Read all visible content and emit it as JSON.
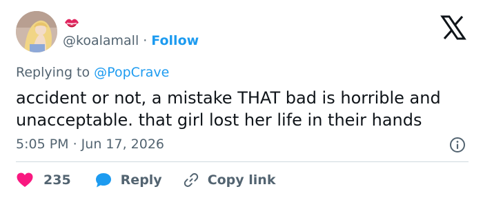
{
  "tweet": {
    "display_name_emoji": "kiss-mark-icon",
    "handle": "@koalamall",
    "separator": "·",
    "follow_label": "Follow",
    "replying_prefix": "Replying to",
    "replying_to": "@PopCrave",
    "text_line1": "accident or not, a mistake THAT bad is horrible and",
    "text_line2": "unacceptable. that girl lost her life in their hands",
    "timestamp": "5:05 PM · Jun 17, 2026",
    "like_count": "235",
    "reply_label": "Reply",
    "copy_link_label": "Copy link"
  },
  "icons": {
    "brand": "x-logo-icon",
    "info": "info-icon",
    "like": "heart-icon",
    "reply": "speech-bubble-icon",
    "copy": "link-icon"
  },
  "colors": {
    "link_blue": "#1d9bf0",
    "like_pink": "#f91880",
    "muted": "#536471",
    "text": "#0f1419",
    "divider": "#cfd9de",
    "emoji_red": "#e0245e"
  }
}
